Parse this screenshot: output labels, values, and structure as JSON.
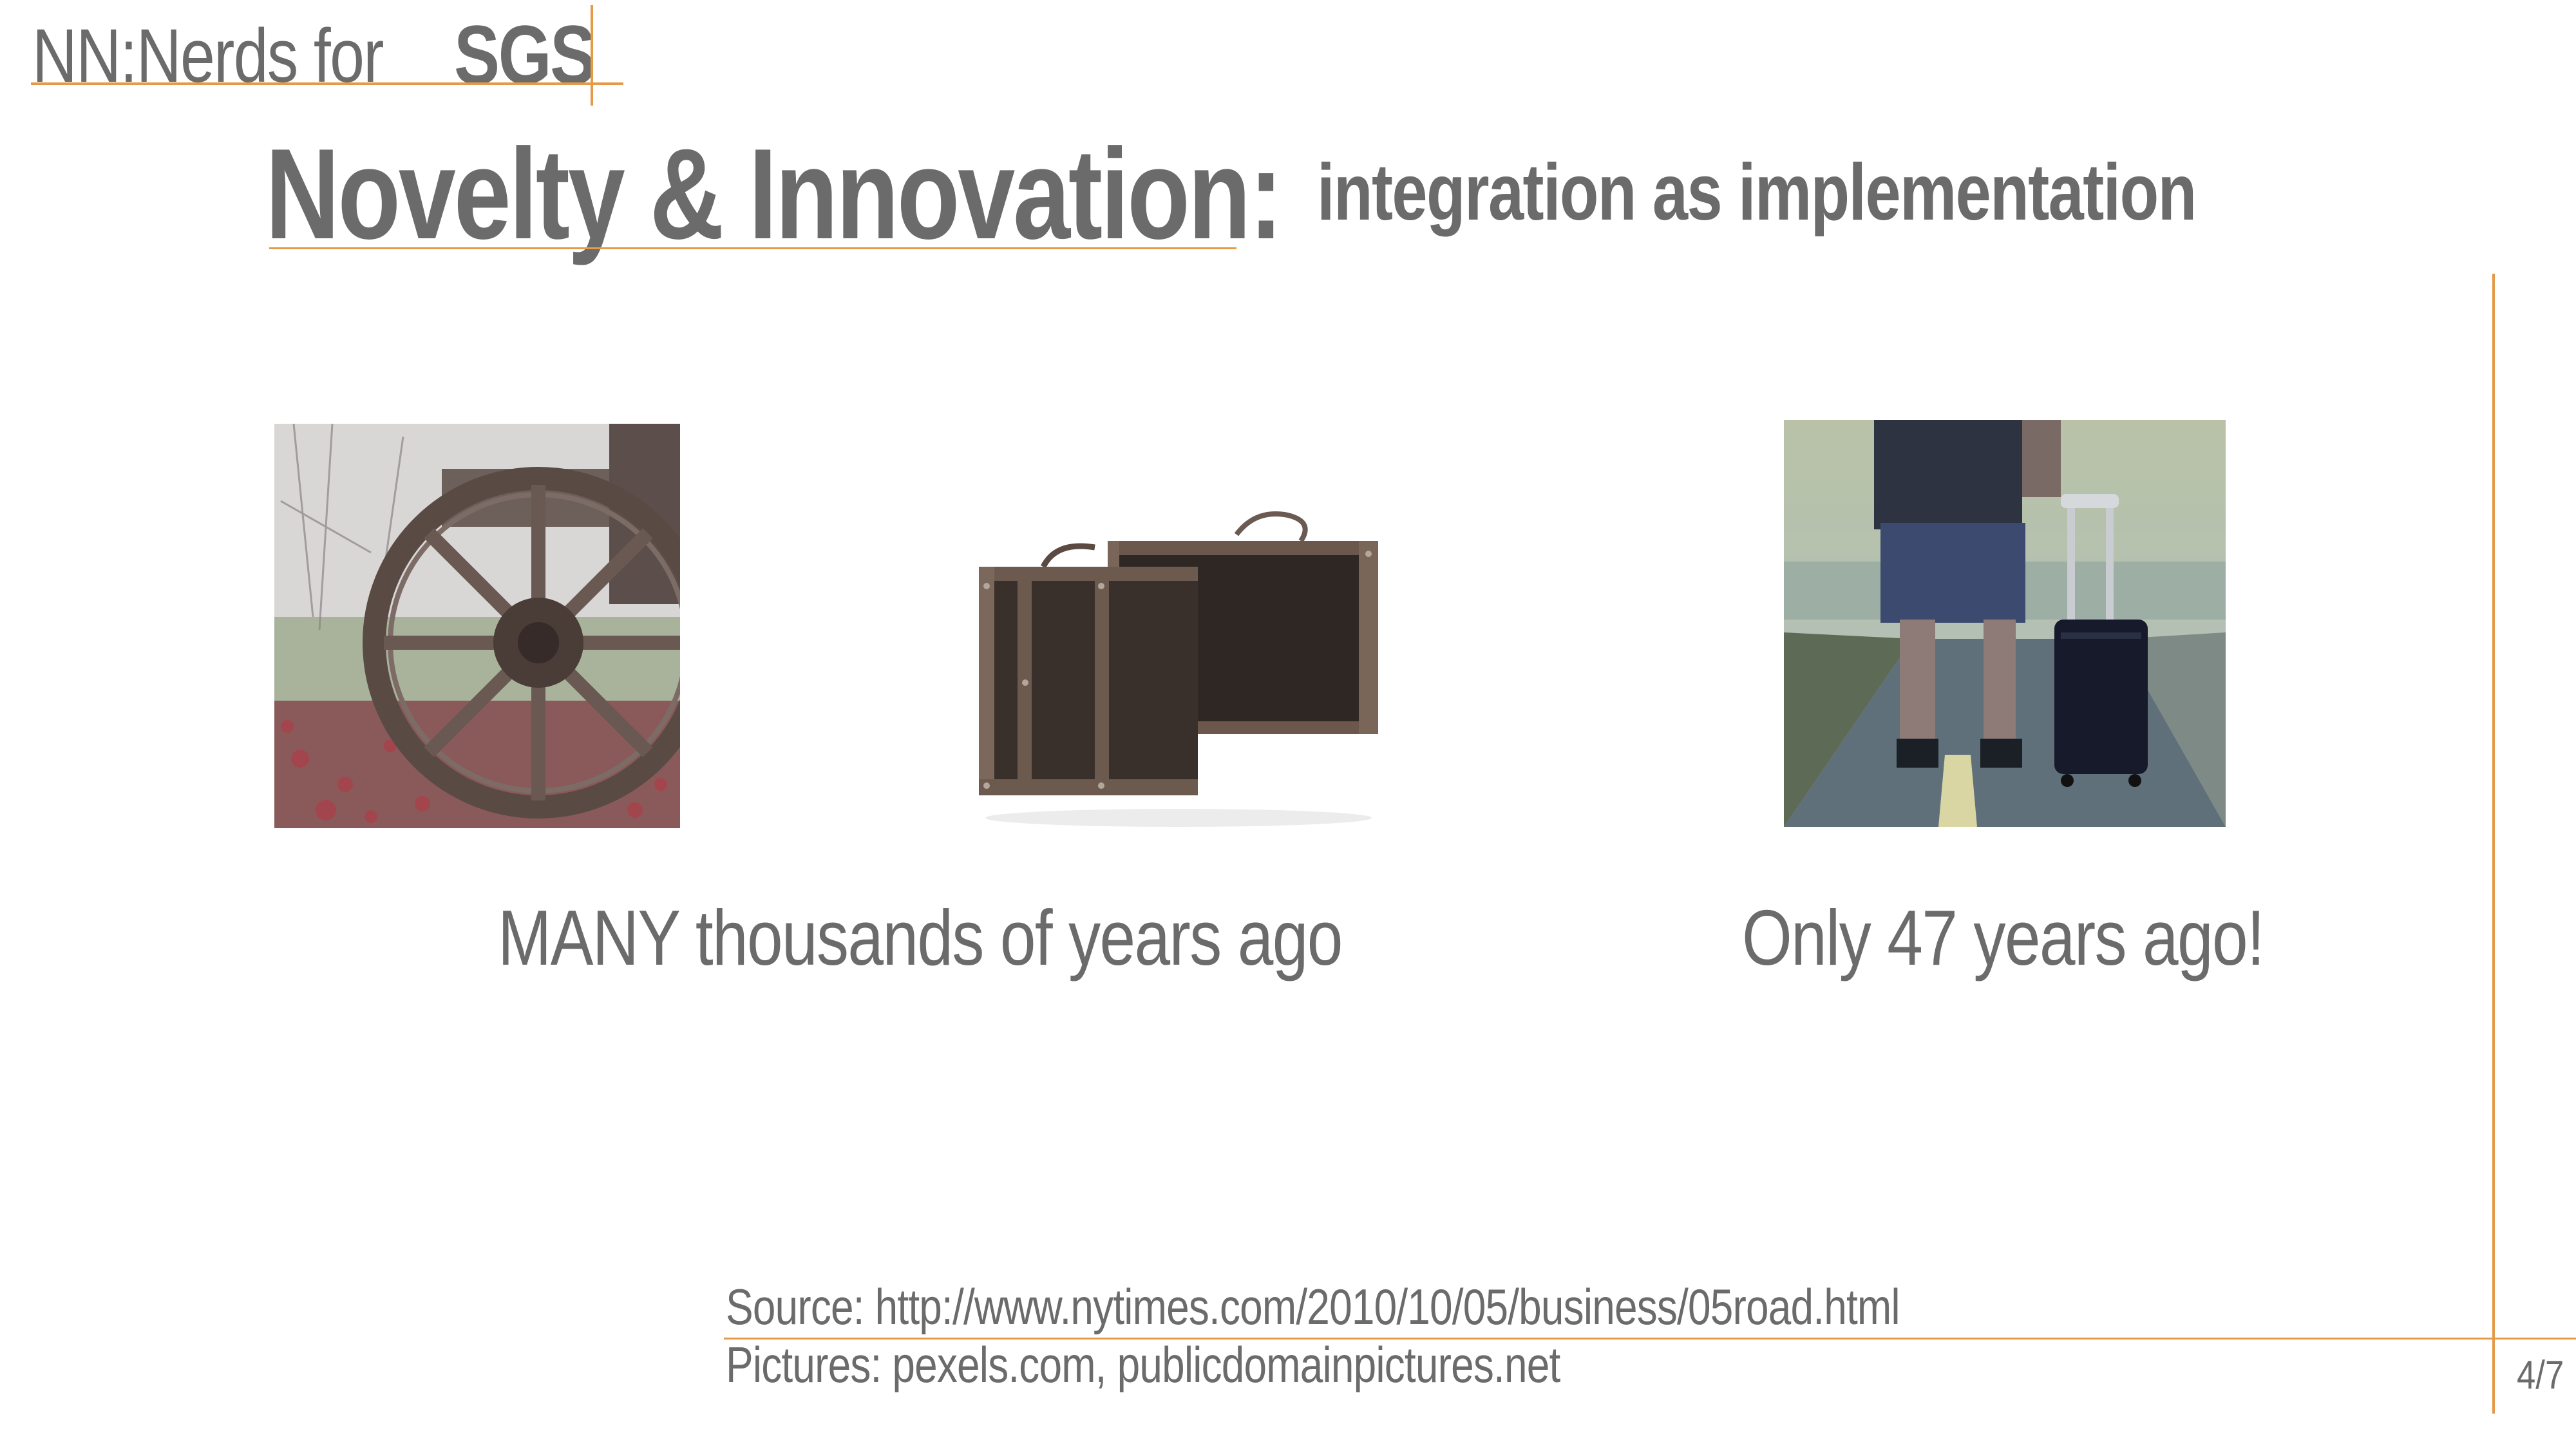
{
  "brand": {
    "prefix": "NN:Nerds for",
    "name": "SGS",
    "accent_color": "#e59a4a"
  },
  "slide": {
    "title": "Novelty & Innovation:",
    "subtitle": "integration as implementation",
    "page": "4/7"
  },
  "images": [
    {
      "name": "wooden-wagon-wheel-photo"
    },
    {
      "name": "old-suitcases-photo"
    },
    {
      "name": "rolling-suitcase-traveler-photo"
    }
  ],
  "captions": {
    "left": "MANY thousands of years ago",
    "right": "Only 47 years ago!"
  },
  "footer": {
    "source": "Source: http://www.nytimes.com/2010/10/05/business/05road.html",
    "pictures": "Pictures: pexels.com, publicdomainpictures.net"
  }
}
